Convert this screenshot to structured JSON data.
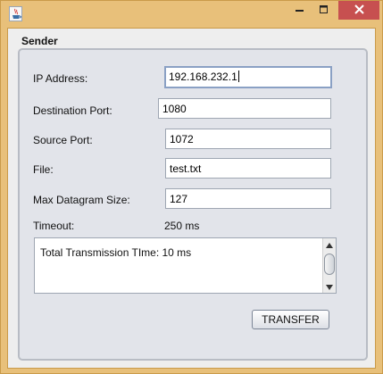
{
  "window": {
    "icon": "java-cup-icon",
    "controls": {
      "minimize_icon": "minimize-icon",
      "maximize_icon": "maximize-icon",
      "close_icon": "close-icon"
    },
    "colors": {
      "frame": "#e8c07a",
      "close_button": "#c75050"
    }
  },
  "panel": {
    "title": "Sender"
  },
  "form": {
    "ip_address": {
      "label": "IP Address:",
      "value": "192.168.232.1"
    },
    "destination_port": {
      "label": "Destination Port:",
      "value": "1080"
    },
    "source_port": {
      "label": "Source Port:",
      "value": "1072"
    },
    "file": {
      "label": "File:",
      "value": "test.txt"
    },
    "max_datagram_size": {
      "label": "Max Datagram Size:",
      "value": "127"
    },
    "timeout": {
      "label": "Timeout:",
      "value": "250 ms"
    }
  },
  "output": {
    "text": "Total Transmission TIme: 10 ms"
  },
  "actions": {
    "transfer_label": "TRANSFER"
  }
}
